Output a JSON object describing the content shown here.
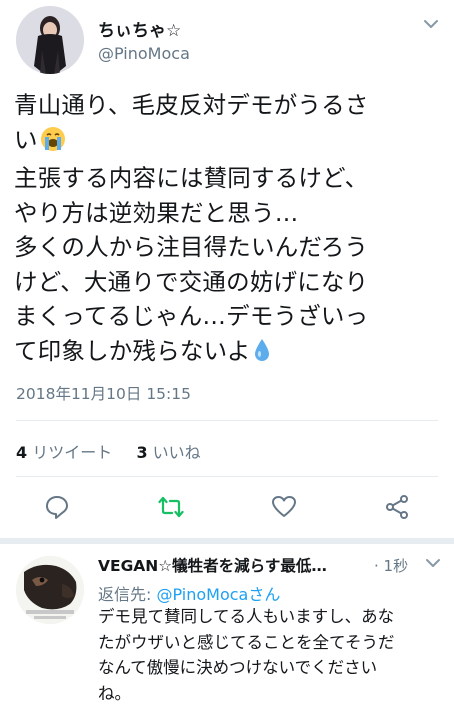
{
  "tweet": {
    "display_name": "ちぃちゃ☆",
    "handle": "@PinoMoca",
    "body_lines": [
      "青山通り、毛皮反対デモがうるさ",
      "い",
      "主張する内容には賛同するけど、",
      "やり方は逆効果だと思う…",
      "多くの人から注目得たいんだろう",
      "けど、大通りで交通の妨げになり",
      "まくってるじゃん…デモうざいっ",
      "て印象しか残らないよ"
    ],
    "timestamp": "2018年11月10日 15:15",
    "retweet_count": "4",
    "retweet_label": "リツイート",
    "like_count": "3",
    "like_label": "いいね",
    "icons": {
      "crying_emoji": "loudly-crying-face",
      "droplet_emoji": "droplet",
      "caret": "chevron-down",
      "reply": "speech-bubble",
      "retweet": "retweet-arrows",
      "like": "heart",
      "share": "share-nodes"
    }
  },
  "reply": {
    "display_name": "VEGAN☆犠牲者を減らす最低…",
    "time": "· 1秒",
    "reply_to_label": "返信先: ",
    "reply_to_handle": "@PinoMocaさん",
    "body_lines": [
      "デモ見て賛同してる人もいますし、あな",
      "たがウザいと感じてることを全てそうだ",
      "なんて傲慢に決めつけないでください",
      "ね。"
    ]
  },
  "colors": {
    "text": "#14171a",
    "secondary": "#657786",
    "link": "#1da1f2",
    "retweet_active": "#17bf63",
    "divider": "#e6ecf0"
  }
}
